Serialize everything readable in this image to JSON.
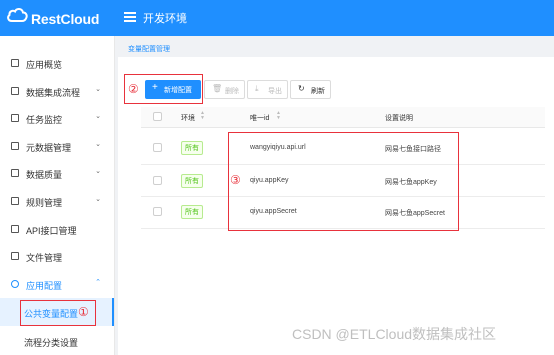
{
  "header": {
    "logo_text": "RestCloud",
    "env_title": "开发环境",
    "colors": {
      "primary": "#1f8fff"
    }
  },
  "sidebar": {
    "items": [
      {
        "label": "应用概览",
        "chevron": ""
      },
      {
        "label": "数据集成流程",
        "chevron": "⌄"
      },
      {
        "label": "任务监控",
        "chevron": "⌄"
      },
      {
        "label": "元数据管理",
        "chevron": "⌄"
      },
      {
        "label": "数据质量",
        "chevron": "⌄"
      },
      {
        "label": "规则管理",
        "chevron": "⌄"
      },
      {
        "label": "API接口管理",
        "chevron": ""
      },
      {
        "label": "文件管理",
        "chevron": ""
      },
      {
        "label": "应用配置",
        "chevron": "⌃"
      }
    ],
    "sub_items": [
      {
        "label": "公共变量配置"
      },
      {
        "label": "流程分类设置"
      }
    ]
  },
  "breadcrumb": "变量配置管理",
  "toolbar": {
    "add_label": "新增配置",
    "delete_label": "删除",
    "export_label": "导出",
    "refresh_label": "刷新"
  },
  "table": {
    "columns": {
      "env": "环境",
      "id": "唯一id",
      "desc": "设置说明"
    },
    "rows": [
      {
        "env": "所有",
        "id": "wangyiqiyu.api.url",
        "desc": "网易七鱼接口路径"
      },
      {
        "env": "所有",
        "id": "qiyu.appKey",
        "desc": "网易七鱼appKey"
      },
      {
        "env": "所有",
        "id": "qiyu.appSecret",
        "desc": "网易七鱼appSecret"
      }
    ]
  },
  "annotations": {
    "n1": "①",
    "n2": "②",
    "n3": "③",
    "color": "#e8323c"
  },
  "watermark": "CSDN @ETLCloud数据集成社区"
}
